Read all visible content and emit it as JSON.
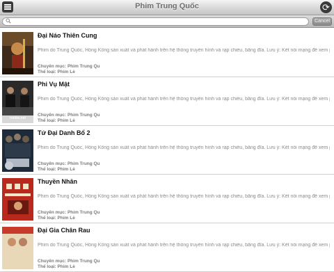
{
  "navbar": {
    "title": "Phim Trung Quốc"
  },
  "search": {
    "placeholder": "",
    "value": "",
    "cancel_label": "Cancel"
  },
  "movies": [
    {
      "title": "Đại Náo Thiên Cung",
      "description": "Phim do Trung Quốc, Hồng Kông sản xuất và phát hành trên hệ thống truyền hình và rạp chiếu, băng đĩa. Lưu ý: Kết nối mạng để xem phim",
      "category": "Chuyên mục: Phim Trung Qu",
      "genre": "Thể loại: Phim Lẻ",
      "poster_icon": "monkey-king-poster",
      "poster_text": ""
    },
    {
      "title": "Phi Vụ Mật",
      "description": "Phim do Trung Quốc, Hồng Kông sản xuất và phát hành trên hệ thống truyền hình và rạp chiếu, băng đĩa. Lưu ý: Kết nối mạng để xem phim",
      "category": "Chuyên mục: Phim Trung Qu",
      "genre": "Thể loại: Phim Lẻ",
      "poster_icon": "action-movie-poster",
      "poster_text": "ronbo.net"
    },
    {
      "title": "Tứ Đại Danh Bổ 2",
      "description": "Phim do Trung Quốc, Hồng Kông sản xuất và phát hành trên hệ thống truyền hình và rạp chiếu, băng đĩa. Lưu ý: Kết nối mạng để xem phim",
      "category": "Chuyên mục: Phim Trung Qu",
      "genre": "Thể loại: Phim Lẻ",
      "poster_icon": "four-heroes-poster",
      "poster_text": ""
    },
    {
      "title": "Thuyền Nhân",
      "description": "Phim do Trung Quốc, Hồng Kông sản xuất và phát hành trên hệ thống truyền hình và rạp chiếu, băng đĩa. Lưu ý: Kết nối mạng để xem phim",
      "category": "Chuyên mục: Phim Trung Qu",
      "genre": "Thể loại: Phim Lẻ",
      "poster_icon": "boat-people-poster",
      "poster_text": ""
    },
    {
      "title": "Đại Gia Chân Rau",
      "description": "Phim do Trung Quốc, Hồng Kông sản xuất và phát hành trên hệ thống truyền hình và rạp chiếu, băng đĩa. Lưu ý: Kết nối mạng để xem phim",
      "category": "Chuyên mục: Phim Trung Qu",
      "genre": "Thể loại: Phim Lẻ",
      "poster_icon": "comedy-poster",
      "poster_text": ""
    }
  ],
  "colors": {
    "navbar_top": "#f4f4f4",
    "navbar_bottom": "#c4c4c4",
    "title_text": "#6e6e6e",
    "description_text": "#8a8a8a"
  }
}
